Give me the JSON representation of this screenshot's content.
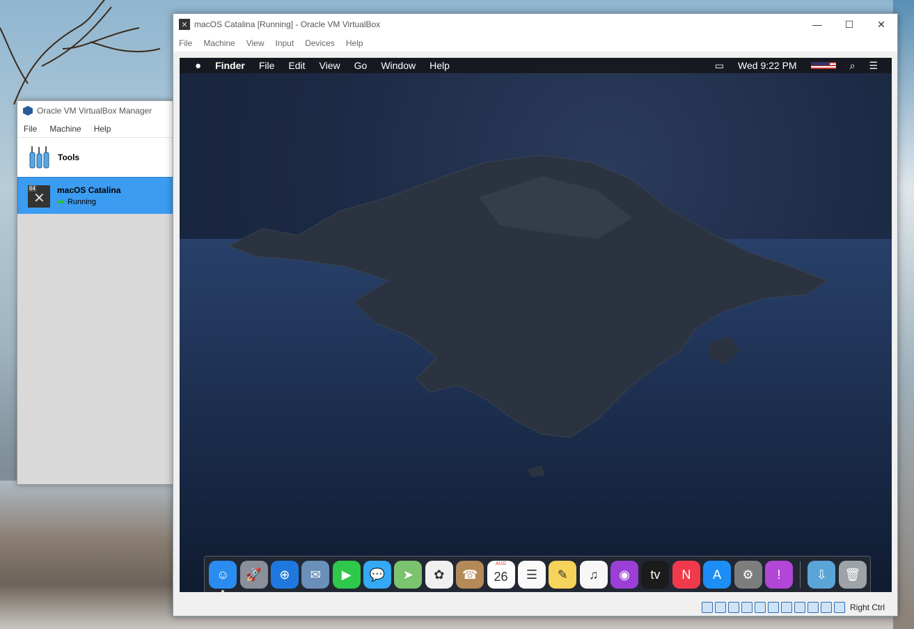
{
  "manager": {
    "title": "Oracle VM VirtualBox Manager",
    "menu": [
      "File",
      "Machine",
      "Help"
    ],
    "tools_label": "Tools",
    "vm": {
      "name": "macOS Catalina",
      "state": "Running",
      "badge": "64"
    }
  },
  "vm_window": {
    "title": "macOS Catalina [Running] - Oracle VM VirtualBox",
    "menu": [
      "File",
      "Machine",
      "View",
      "Input",
      "Devices",
      "Help"
    ],
    "host_key": "Right Ctrl"
  },
  "mac": {
    "menubar": {
      "app": "Finder",
      "items": [
        "File",
        "Edit",
        "View",
        "Go",
        "Window",
        "Help"
      ],
      "clock": "Wed 9:22 PM"
    },
    "dock": {
      "apps": [
        {
          "name": "Finder",
          "color": "#2a8cf0",
          "glyph": "☺",
          "running": true
        },
        {
          "name": "Launchpad",
          "color": "#8a8f99",
          "glyph": "🚀"
        },
        {
          "name": "Safari",
          "color": "#1f78e0",
          "glyph": "⊕"
        },
        {
          "name": "Mail",
          "color": "#6a8fb8",
          "glyph": "✉"
        },
        {
          "name": "FaceTime",
          "color": "#2ec84a",
          "glyph": "▶"
        },
        {
          "name": "Messages",
          "color": "#34a9f5",
          "glyph": "💬"
        },
        {
          "name": "Maps",
          "color": "#7cc36f",
          "glyph": "➤"
        },
        {
          "name": "Photos",
          "color": "#f0f0f0",
          "glyph": "✿"
        },
        {
          "name": "Contacts",
          "color": "#b48a58",
          "glyph": "☎"
        },
        {
          "name": "Calendar",
          "color": "#ffffff",
          "glyph": "26",
          "month": "AUG"
        },
        {
          "name": "Reminders",
          "color": "#fafafa",
          "glyph": "☰"
        },
        {
          "name": "Notes",
          "color": "#f6d35a",
          "glyph": "✎"
        },
        {
          "name": "Music",
          "color": "#f7f7f7",
          "glyph": "♫"
        },
        {
          "name": "Podcasts",
          "color": "#9b3fd6",
          "glyph": "◉"
        },
        {
          "name": "TV",
          "color": "#1b1b1b",
          "glyph": "tv"
        },
        {
          "name": "News",
          "color": "#f03a4c",
          "glyph": "N"
        },
        {
          "name": "App Store",
          "color": "#1c8ef5",
          "glyph": "A"
        },
        {
          "name": "System Preferences",
          "color": "#7d7d7d",
          "glyph": "⚙"
        },
        {
          "name": "Feedback Assistant",
          "color": "#b246d6",
          "glyph": "!"
        }
      ],
      "extras": [
        {
          "name": "Downloads",
          "color": "#5aa4d8",
          "glyph": "⇩"
        },
        {
          "name": "Trash",
          "color": "#9ea3a8",
          "glyph": "🗑"
        }
      ]
    }
  }
}
